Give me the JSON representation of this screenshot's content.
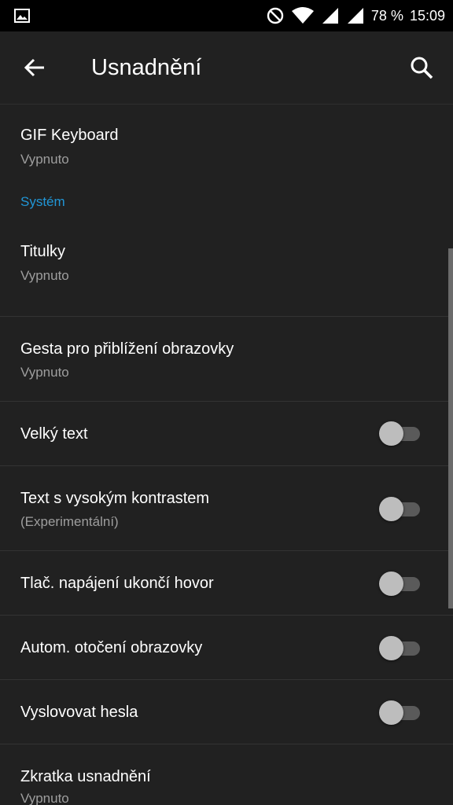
{
  "status_bar": {
    "battery": "78 %",
    "time": "15:09",
    "icons": [
      "image-icon",
      "dnd-icon",
      "wifi-icon",
      "signal-icon",
      "signal-icon",
      "battery-icon"
    ]
  },
  "app_bar": {
    "title": "Usnadnění",
    "back_icon": "arrow-back-icon",
    "search_icon": "search-icon"
  },
  "items": {
    "gif_keyboard": {
      "label": "GIF Keyboard",
      "sub": "Vypnuto"
    },
    "section_system": "Systém",
    "titulky": {
      "label": "Titulky",
      "sub": "Vypnuto"
    },
    "gesta": {
      "label": "Gesta pro přiblížení obrazovky",
      "sub": "Vypnuto"
    },
    "velky_text": {
      "label": "Velký text",
      "toggle": false
    },
    "kontrast": {
      "label": "Text s vysokým kontrastem",
      "sub": "(Experimentální)",
      "toggle": false
    },
    "napajeni": {
      "label": "Tlač. napájení ukončí hovor",
      "toggle": false
    },
    "otoceni": {
      "label": "Autom. otočení obrazovky",
      "toggle": false
    },
    "hesla": {
      "label": "Vyslovovat hesla",
      "toggle": false
    },
    "zkratka": {
      "label": "Zkratka usnadnění",
      "sub": "Vypnuto"
    }
  },
  "colors": {
    "background": "#212121",
    "status_bar": "#000000",
    "accent": "#2196d6",
    "primary_text": "#ffffff",
    "secondary_text": "#9e9e9e"
  }
}
